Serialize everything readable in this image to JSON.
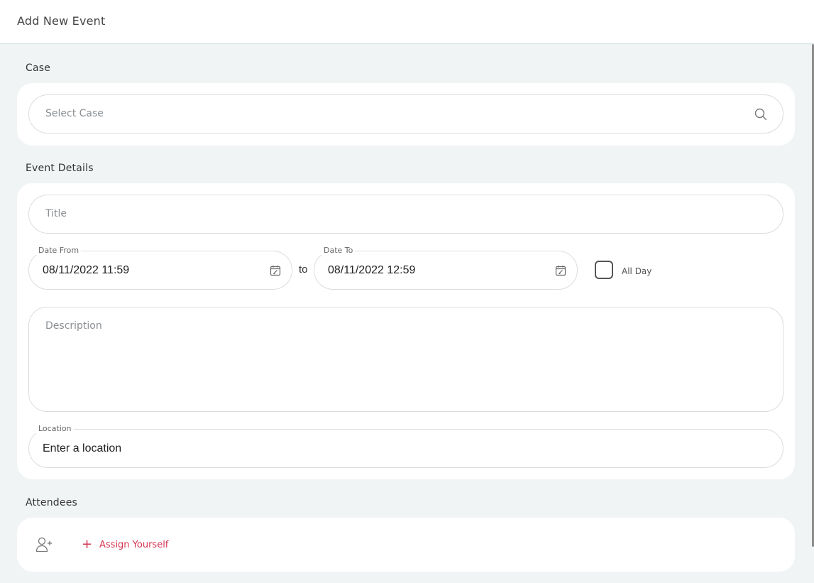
{
  "header": {
    "title": "Add New Event"
  },
  "case_section": {
    "label": "Case",
    "select_placeholder": "Select Case"
  },
  "event_details": {
    "label": "Event Details",
    "title_placeholder": "Title",
    "date_from": {
      "label": "Date From",
      "value": "08/11/2022 11:59"
    },
    "to_text": "to",
    "date_to": {
      "label": "Date To",
      "value": "08/11/2022 12:59"
    },
    "all_day": {
      "label": "All Day",
      "checked": false
    },
    "description_placeholder": "Description",
    "location": {
      "label": "Location",
      "value": "Enter a location"
    }
  },
  "attendees": {
    "label": "Attendees",
    "assign_label": "Assign Yourself"
  },
  "colors": {
    "accent": "#d6334f",
    "page_bg": "#f1f4f5",
    "card_bg": "#ffffff",
    "border": "#d9dde1"
  },
  "icons": {
    "search": "search-icon",
    "calendar": "calendar-edit-icon",
    "add_user": "add-user-icon",
    "plus": "plus-icon"
  }
}
